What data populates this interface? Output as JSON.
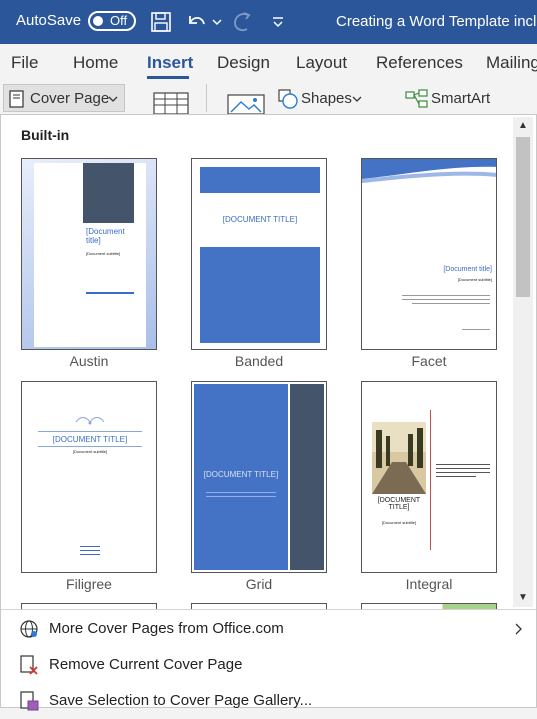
{
  "titlebar": {
    "autosave_label": "AutoSave",
    "toggle_state": "Off",
    "document_title": "Creating a Word Template incl"
  },
  "tabs": [
    "File",
    "Home",
    "Insert",
    "Design",
    "Layout",
    "References",
    "Mailing"
  ],
  "active_tab": "Insert",
  "ribbon": {
    "cover_page": "Cover Page",
    "shapes": "Shapes",
    "smartart": "SmartArt"
  },
  "gallery": {
    "section_heading": "Built-in",
    "items": [
      {
        "name": "Austin",
        "title": "[Document title]",
        "subtitle": "[Document subtitle]"
      },
      {
        "name": "Banded",
        "title": "[DOCUMENT TITLE]"
      },
      {
        "name": "Facet",
        "title": "[Document title]",
        "subtitle": "[Document subtitle]"
      },
      {
        "name": "Filigree",
        "title": "[DOCUMENT TITLE]",
        "subtitle": "[Document subtitle]"
      },
      {
        "name": "Grid",
        "title": "[DOCUMENT TITLE]"
      },
      {
        "name": "Integral",
        "title": "[DOCUMENT TITLE]",
        "subtitle": "[Document subtitle]"
      }
    ]
  },
  "menu": {
    "more": "More Cover Pages from Office.com",
    "remove": "Remove Current Cover Page",
    "save": "Save Selection to Cover Page Gallery..."
  },
  "colors": {
    "title_bar": "#2b579a",
    "accent_blue": "#4472c4",
    "grid_dark": "#44546a"
  }
}
